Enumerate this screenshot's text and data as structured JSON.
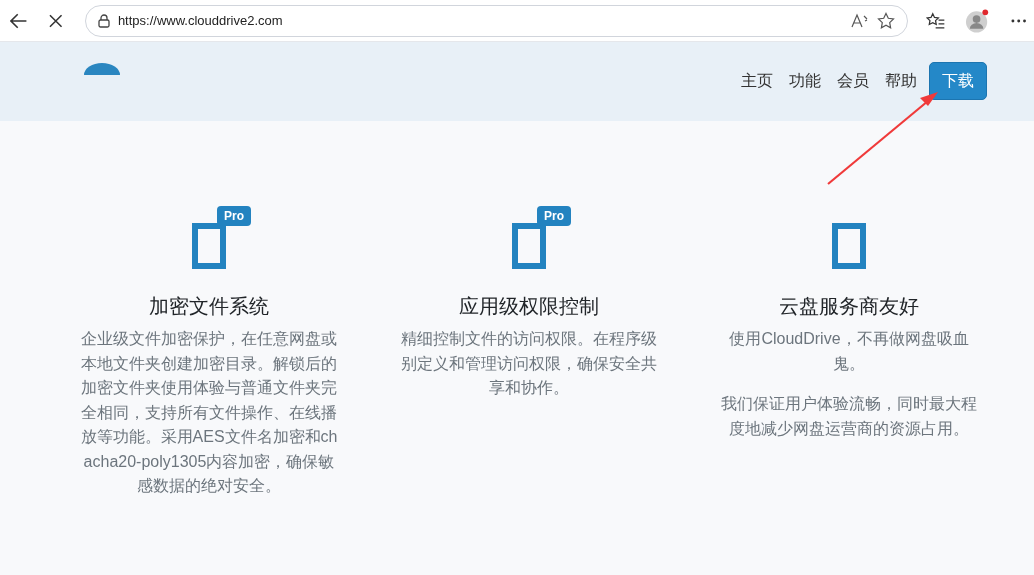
{
  "browser": {
    "url": "https://www.clouddrive2.com"
  },
  "nav": {
    "links": [
      {
        "label": "主页"
      },
      {
        "label": "功能"
      },
      {
        "label": "会员"
      },
      {
        "label": "帮助"
      }
    ],
    "download_button": "下载"
  },
  "features": [
    {
      "title": "加密文件系统",
      "badge": "Pro",
      "paragraphs": [
        "企业级文件加密保护，在任意网盘或本地文件夹创建加密目录。解锁后的加密文件夹使用体验与普通文件夹完全相同，支持所有文件操作、在线播放等功能。采用AES文件名加密和chacha20-poly1305内容加密，确保敏感数据的绝对安全。"
      ]
    },
    {
      "title": "应用级权限控制",
      "badge": "Pro",
      "paragraphs": [
        "精细控制文件的访问权限。在程序级别定义和管理访问权限，确保安全共享和协作。"
      ]
    },
    {
      "title": "云盘服务商友好",
      "paragraphs": [
        "使用CloudDrive，不再做网盘吸血鬼。",
        "我们保证用户体验流畅，同时最大程度地减少网盘运营商的资源占用。"
      ]
    }
  ]
}
